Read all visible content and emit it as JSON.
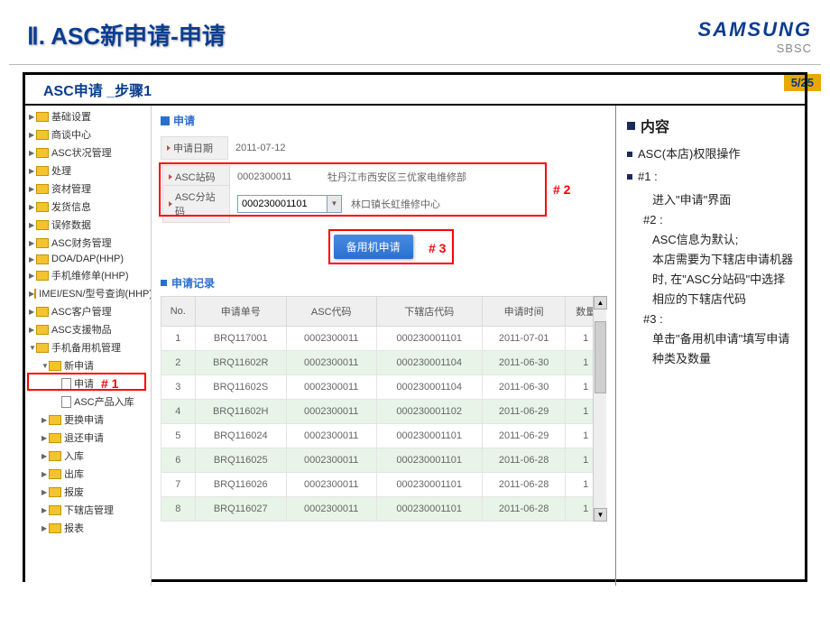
{
  "page_number": "5/25",
  "title": "Ⅱ. ASC新申请-申请",
  "brand": {
    "logo": "SAMSUNG",
    "sub": "SBSC"
  },
  "subheader": "ASC申请 _步骤1",
  "sidebar": [
    {
      "label": "基础设置",
      "type": "folder",
      "indent": 0
    },
    {
      "label": "商谈中心",
      "type": "folder",
      "indent": 0
    },
    {
      "label": "ASC状况管理",
      "type": "folder",
      "indent": 0
    },
    {
      "label": "处理",
      "type": "folder",
      "indent": 0
    },
    {
      "label": "资材管理",
      "type": "folder",
      "indent": 0
    },
    {
      "label": "发货信息",
      "type": "folder",
      "indent": 0
    },
    {
      "label": "误修数据",
      "type": "folder",
      "indent": 0
    },
    {
      "label": "ASC财务管理",
      "type": "folder",
      "indent": 0
    },
    {
      "label": "DOA/DAP(HHP)",
      "type": "folder",
      "indent": 0
    },
    {
      "label": "手机维修单(HHP)",
      "type": "folder",
      "indent": 0
    },
    {
      "label": "IMEI/ESN/型号查询(HHP)",
      "type": "folder",
      "indent": 0
    },
    {
      "label": "ASC客户管理",
      "type": "folder",
      "indent": 0
    },
    {
      "label": "ASC支援物品",
      "type": "folder",
      "indent": 0
    },
    {
      "label": "手机备用机管理",
      "type": "folder",
      "indent": 0,
      "expanded": true
    },
    {
      "label": "新申请",
      "type": "folder",
      "indent": 1,
      "expanded": true
    },
    {
      "label": "申请",
      "type": "doc",
      "indent": 2,
      "highlight": true
    },
    {
      "label": "ASC产品入库",
      "type": "doc",
      "indent": 2
    },
    {
      "label": "更换申请",
      "type": "folder",
      "indent": 1
    },
    {
      "label": "退还申请",
      "type": "folder",
      "indent": 1
    },
    {
      "label": "入库",
      "type": "folder",
      "indent": 1
    },
    {
      "label": "出库",
      "type": "folder",
      "indent": 1
    },
    {
      "label": "报废",
      "type": "folder",
      "indent": 1
    },
    {
      "label": "下辖店管理",
      "type": "folder",
      "indent": 1
    },
    {
      "label": "报表",
      "type": "folder",
      "indent": 1
    }
  ],
  "form": {
    "title": "申请",
    "date_label": "申请日期",
    "date_value": "2011-07-12",
    "asc_code_label": "ASC站码",
    "asc_code_value": "0002300011",
    "asc_code_desc": "牡丹江市西安区三优家电维修部",
    "asc_sub_label": "ASC分站码",
    "asc_sub_value": "000230001101",
    "asc_sub_desc": "林口镇长虹维修中心",
    "button": "备用机申请"
  },
  "annotations": {
    "a1": "# 1",
    "a2": "# 2",
    "a3": "# 3"
  },
  "list_title": "申请记录",
  "table": {
    "headers": [
      "No.",
      "申请单号",
      "ASC代码",
      "下辖店代码",
      "申请时间",
      "数量"
    ],
    "rows": [
      [
        "1",
        "BRQ117001",
        "0002300011",
        "000230001101",
        "2011-07-01",
        "1"
      ],
      [
        "2",
        "BRQ11602R",
        "0002300011",
        "000230001104",
        "2011-06-30",
        "1"
      ],
      [
        "3",
        "BRQ11602S",
        "0002300011",
        "000230001104",
        "2011-06-30",
        "1"
      ],
      [
        "4",
        "BRQ11602H",
        "0002300011",
        "000230001102",
        "2011-06-29",
        "1"
      ],
      [
        "5",
        "BRQ116024",
        "0002300011",
        "000230001101",
        "2011-06-29",
        "1"
      ],
      [
        "6",
        "BRQ116025",
        "0002300011",
        "000230001101",
        "2011-06-28",
        "1"
      ],
      [
        "7",
        "BRQ116026",
        "0002300011",
        "000230001101",
        "2011-06-28",
        "1"
      ],
      [
        "8",
        "BRQ116027",
        "0002300011",
        "000230001101",
        "2011-06-28",
        "1"
      ]
    ]
  },
  "right": {
    "title": "内容",
    "items": [
      "ASC(本店)权限操作",
      "#1 :",
      "#2 :",
      "#3 :"
    ],
    "sub1": "进入\"申请\"界面",
    "sub2a": "ASC信息为默认;",
    "sub2b": "本店需要为下辖店申请机器时, 在\"ASC分站码\"中选择相应的下辖店代码",
    "sub3": "单击\"备用机申请\"填写申请种类及数量"
  }
}
